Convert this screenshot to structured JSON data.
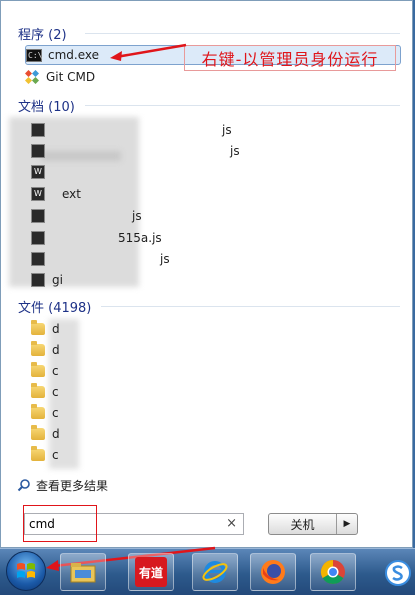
{
  "programs": {
    "header": "程序 (2)",
    "items": [
      {
        "label": "cmd.exe",
        "icon": "cmd-icon"
      },
      {
        "label": "Git CMD",
        "icon": "git-icon"
      }
    ]
  },
  "documents": {
    "header": "文档 (10)",
    "items": [
      {
        "label": "js"
      },
      {
        "label": "js"
      },
      {
        "label": "ext"
      },
      {
        "label": "js"
      },
      {
        "label": "515a.js"
      },
      {
        "label": "js"
      },
      {
        "label": "gi"
      }
    ]
  },
  "files": {
    "header": "文件 (4198)",
    "items": [
      {
        "label": "d"
      },
      {
        "label": "d"
      },
      {
        "label": "c"
      },
      {
        "label": "c"
      },
      {
        "label": "c"
      },
      {
        "label": "d"
      },
      {
        "label": "c"
      }
    ]
  },
  "annotation": {
    "text": "右键-以管理员身份运行",
    "color": "#e0151a"
  },
  "more_results": "查看更多结果",
  "search": {
    "value": "cmd",
    "clear": "×"
  },
  "shutdown": {
    "label": "关机",
    "arrow": "▶"
  },
  "taskbar": {
    "youdao_label": "有道",
    "apps": [
      "explorer-icon",
      "youdao-icon",
      "ie-icon",
      "firefox-icon",
      "chrome-icon",
      "sogou-icon"
    ]
  }
}
